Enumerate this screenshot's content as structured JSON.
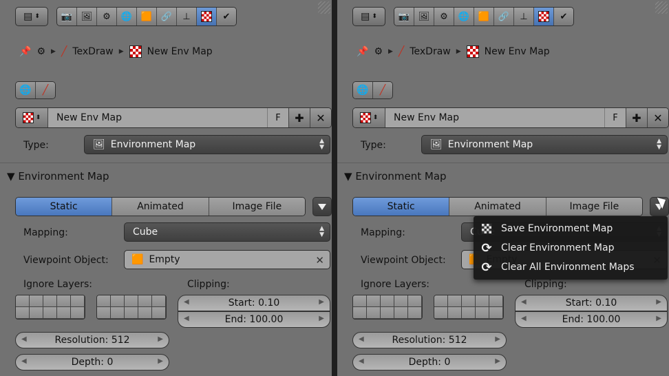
{
  "breadcrumb": {
    "item1": "TexDraw",
    "item2": "New Env Map"
  },
  "id_block": {
    "name": "New Env Map",
    "fake_user": "F"
  },
  "type_field": {
    "label": "Type:",
    "value": "Environment Map"
  },
  "section": {
    "title": "Environment Map",
    "arrow": "▼"
  },
  "source_tabs": [
    "Static",
    "Animated",
    "Image File"
  ],
  "mapping": {
    "label": "Mapping:",
    "value": "Cube"
  },
  "viewpoint": {
    "label": "Viewpoint Object:",
    "value": "Empty"
  },
  "ignore_layers_label": "Ignore Layers:",
  "clipping": {
    "label": "Clipping:",
    "start": "Start: 0.10",
    "end": "End: 100.00"
  },
  "resolution": "Resolution: 512",
  "depth": "Depth: 0",
  "popup_menu": [
    {
      "label": "Save Environment Map",
      "icon": "checker-icon"
    },
    {
      "label": "Clear Environment Map",
      "icon": "refresh-icon"
    },
    {
      "label": "Clear All Environment Maps",
      "icon": "refresh-icon"
    }
  ],
  "colors": {
    "panel": "#727272",
    "accent": "#5a88cc",
    "dropdown": "#4a4a4a",
    "menu": "#191919"
  }
}
